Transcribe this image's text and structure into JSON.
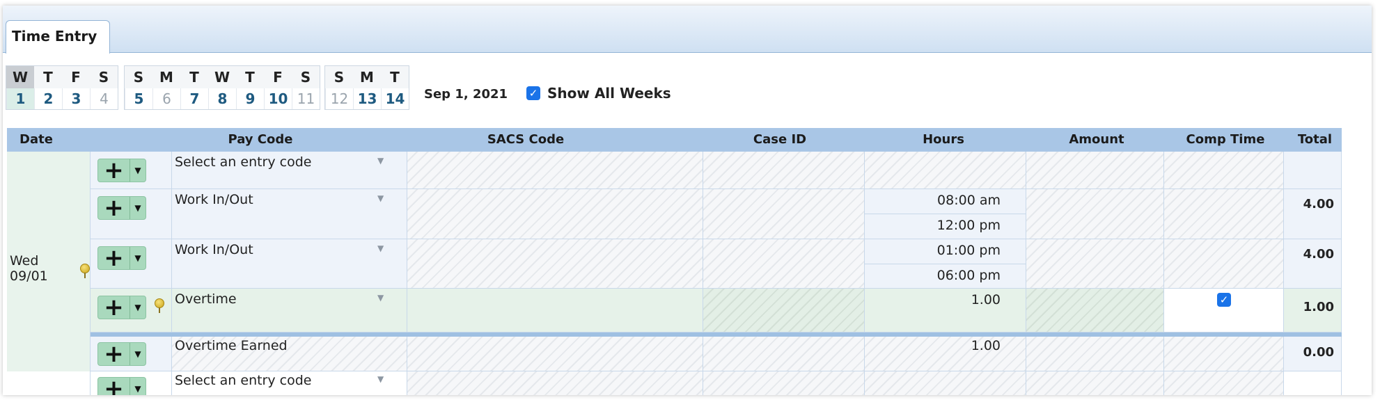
{
  "tab": {
    "label": "Time Entry"
  },
  "calendar": {
    "groups": [
      {
        "days": [
          {
            "letter": "W",
            "num": "1",
            "state": "current"
          },
          {
            "letter": "T",
            "num": "2",
            "state": "normal"
          },
          {
            "letter": "F",
            "num": "3",
            "state": "normal"
          },
          {
            "letter": "S",
            "num": "4",
            "state": "dim"
          }
        ]
      },
      {
        "days": [
          {
            "letter": "S",
            "num": "5",
            "state": "normal"
          },
          {
            "letter": "M",
            "num": "6",
            "state": "dim"
          },
          {
            "letter": "T",
            "num": "7",
            "state": "normal"
          },
          {
            "letter": "W",
            "num": "8",
            "state": "normal"
          },
          {
            "letter": "T",
            "num": "9",
            "state": "normal"
          },
          {
            "letter": "F",
            "num": "10",
            "state": "normal"
          },
          {
            "letter": "S",
            "num": "11",
            "state": "dim"
          }
        ]
      },
      {
        "days": [
          {
            "letter": "S",
            "num": "12",
            "state": "dim"
          },
          {
            "letter": "M",
            "num": "13",
            "state": "normal"
          },
          {
            "letter": "T",
            "num": "14",
            "state": "normal"
          }
        ]
      }
    ],
    "current_date": "Sep 1, 2021",
    "show_all_weeks_label": "Show All Weeks",
    "show_all_weeks_checked": true
  },
  "grid": {
    "headers": {
      "date": "Date",
      "pay_code": "Pay Code",
      "sacs_code": "SACS Code",
      "case_id": "Case ID",
      "hours": "Hours",
      "amount": "Amount",
      "comp_time": "Comp Time",
      "total": "Total"
    },
    "date_label": "Wed 09/01",
    "rows": [
      {
        "pay_code": "Select an entry code",
        "hours": [],
        "total": ""
      },
      {
        "pay_code": "Work In/Out",
        "hours": [
          "08:00 am",
          "12:00 pm"
        ],
        "total": "4.00"
      },
      {
        "pay_code": "Work In/Out",
        "hours": [
          "01:00 pm",
          "06:00 pm"
        ],
        "total": "4.00"
      },
      {
        "pay_code": "Overtime",
        "hours": [
          "1.00"
        ],
        "comp_time_checked": true,
        "total": "1.00"
      },
      {
        "pay_code": "Overtime Earned",
        "hours": [
          "1.00"
        ],
        "total": "0.00"
      },
      {
        "pay_code": "Select an entry code",
        "hours": [],
        "total": ""
      }
    ]
  },
  "icons": {
    "add": "plus-icon",
    "menu": "caret-down-icon",
    "note": "pin-icon",
    "dropdown": "dropdown-arrow-icon",
    "check": "checkmark-icon"
  },
  "colors": {
    "header_bg": "#a9c6e6",
    "button_bg": "#a9d9bd",
    "checkbox": "#1a73e8",
    "current_row": "#e6f2e9"
  }
}
